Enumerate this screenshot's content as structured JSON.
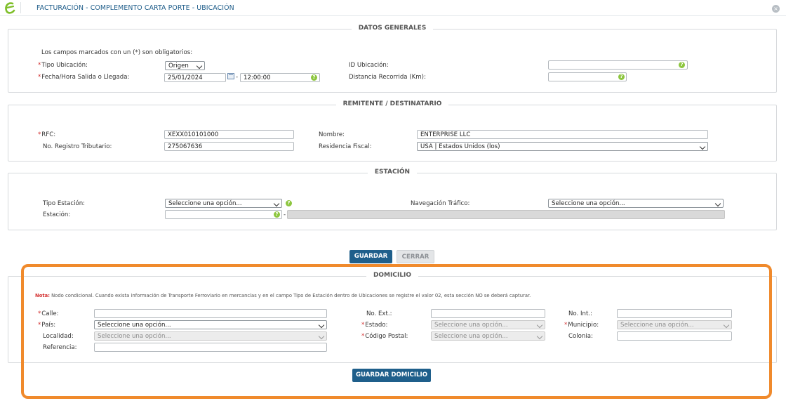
{
  "window": {
    "title": "FACTURACIÓN - COMPLEMENTO CARTA PORTE - UBICACIÓN",
    "close_glyph": "×"
  },
  "datos_generales": {
    "title": "DATOS GENERALES",
    "note": "Los campos marcados con un (*) son obligatorios:",
    "tipo_ubicacion_label": "Tipo Ubicación:",
    "tipo_ubicacion_value": "Origen",
    "fecha_label": "Fecha/Hora Salida o Llegada:",
    "fecha_value": "25/01/2024",
    "hora_sep": "-",
    "hora_value": "12:00:00",
    "id_ubicacion_label": "ID Ubicación:",
    "id_ubicacion_value": "",
    "distancia_label": "Distancia Recorrida (Km):",
    "distancia_value": ""
  },
  "remitente": {
    "title": "REMITENTE / DESTINATARIO",
    "rfc_label": "RFC:",
    "rfc_value": "XEXX010101000",
    "registro_label": "No. Registro Tributario:",
    "registro_value": "275067636",
    "nombre_label": "Nombre:",
    "nombre_value": "ENTERPRISE LLC",
    "residencia_label": "Residencia Fiscal:",
    "residencia_value": "USA | Estados Unidos (los)"
  },
  "estacion": {
    "title": "ESTACIÓN",
    "tipo_estacion_label": "Tipo Estación:",
    "tipo_estacion_value": "Seleccione una opción...",
    "estacion_label": "Estación:",
    "estacion_value": "",
    "estacion_sep": "-",
    "navegacion_label": "Navegación Tráfico:",
    "navegacion_value": "Seleccione una opción..."
  },
  "actions": {
    "guardar": "GUARDAR",
    "cerrar": "CERRAR"
  },
  "domicilio": {
    "title": "DOMICILIO",
    "nota_label": "Nota:",
    "nota_text": " Nodo condicional. Cuando exista información de Transporte Ferroviario en mercancías y en el campo Tipo de Estación dentro de Ubicaciones se registre el valor 02, esta sección NO se deberá capturar.",
    "calle_label": "Calle:",
    "pais_label": "País:",
    "pais_value": "Seleccione una opción...",
    "localidad_label": "Localidad:",
    "localidad_value": "Seleccione una opción...",
    "referencia_label": "Referencia:",
    "no_ext_label": "No. Ext.:",
    "estado_label": "Estado:",
    "estado_value": "Seleccione una opción...",
    "cp_label": "Código Postal:",
    "cp_value": "Seleccione una opción...",
    "no_int_label": "No. Int.:",
    "municipio_label": "Municipio:",
    "municipio_value": "Seleccione una opción...",
    "colonia_label": "Colonia:",
    "guardar_domicilio": "GUARDAR DOMICILIO"
  },
  "help_glyph": "?",
  "required_mark": "*",
  "colors": {
    "brand": "#1f5f8b",
    "accent_green": "#8dc63f",
    "highlight": "#f08a2c",
    "required": "#d32f2f"
  }
}
